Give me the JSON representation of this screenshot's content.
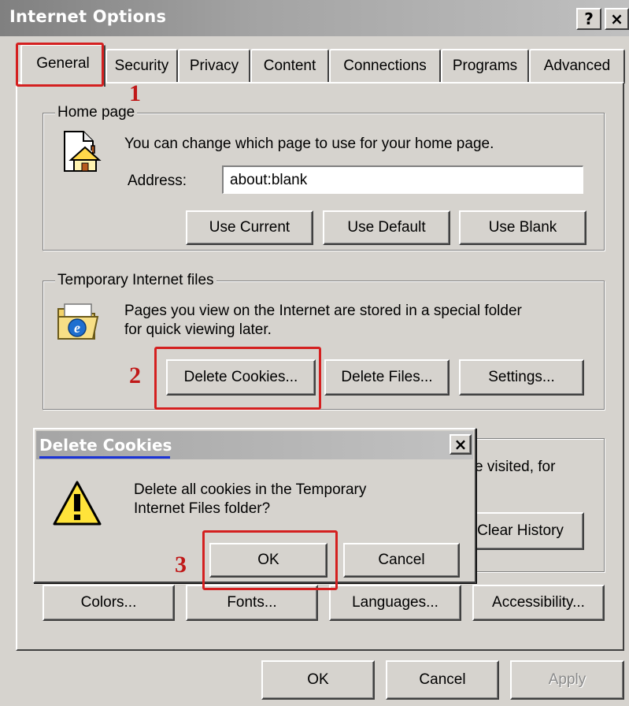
{
  "window": {
    "title": "Internet Options",
    "help_label": "?",
    "close_label": "×"
  },
  "tabs": [
    {
      "label": "General"
    },
    {
      "label": "Security"
    },
    {
      "label": "Privacy"
    },
    {
      "label": "Content"
    },
    {
      "label": "Connections"
    },
    {
      "label": "Programs"
    },
    {
      "label": "Advanced"
    }
  ],
  "home_page": {
    "legend": "Home page",
    "description": "You can change which page to use for your home page.",
    "address_label": "Address:",
    "address_value": "about:blank",
    "use_current": "Use Current",
    "use_default": "Use Default",
    "use_blank": "Use Blank"
  },
  "temp_files": {
    "legend": "Temporary Internet files",
    "description_line1": "Pages you view on the Internet are stored in a special folder",
    "description_line2": "for quick viewing later.",
    "delete_cookies": "Delete Cookies...",
    "delete_files": "Delete Files...",
    "settings": "Settings..."
  },
  "history": {
    "desc_fragment": "e visited, for",
    "clear_history": "Clear History"
  },
  "bottom_row": {
    "colors": "Colors...",
    "fonts": "Fonts...",
    "languages": "Languages...",
    "accessibility": "Accessibility..."
  },
  "footer": {
    "ok": "OK",
    "cancel": "Cancel",
    "apply": "Apply"
  },
  "dialog": {
    "title": "Delete Cookies",
    "close_label": "×",
    "message_line1": "Delete all cookies in the Temporary",
    "message_line2": "Internet Files folder?",
    "ok": "OK",
    "cancel": "Cancel"
  },
  "annotations": {
    "step1": "1",
    "step2": "2",
    "step3": "3"
  },
  "colors": {
    "annotation_red": "#d42020",
    "face": "#d6d3ce"
  }
}
